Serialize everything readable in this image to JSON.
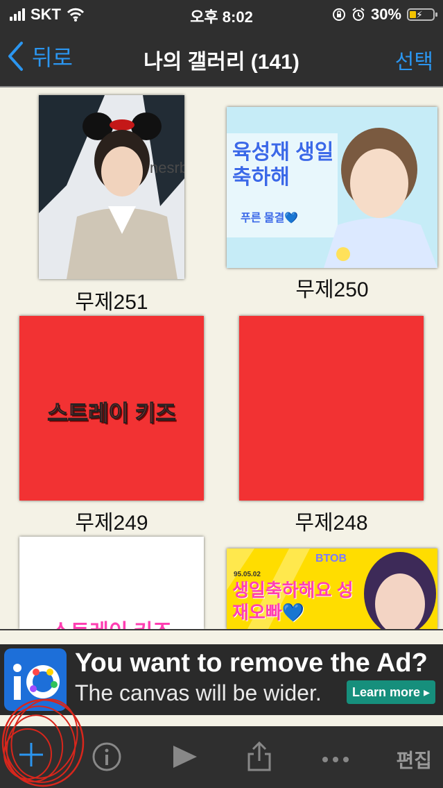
{
  "status": {
    "carrier": "SKT",
    "time": "오후 8:02",
    "battery": "30%"
  },
  "nav": {
    "back_label": "뒤로",
    "title": "나의 갤러리 (141)",
    "select_label": "선택"
  },
  "gallery": {
    "items": [
      {
        "caption": "무제251",
        "text": "nesrby"
      },
      {
        "caption": "무제250",
        "text": "육성재 생일축하해",
        "text2": "푸른 물결💙"
      },
      {
        "caption": "무제249",
        "text": "스트레이 키즈"
      },
      {
        "caption": "무제248"
      },
      {
        "caption": "",
        "text": "스트레이 키즈"
      },
      {
        "caption": "",
        "text": "BTOB",
        "text2": "생일축하해요 성재오빠💙",
        "date": "95.05.02"
      }
    ]
  },
  "ad": {
    "title": "You want to remove the Ad?",
    "subtitle": "The canvas will be wider.",
    "button": "Learn more ▸"
  },
  "toolbar": {
    "edit_label": "편집"
  },
  "colors": {
    "accent": "#2b96f0",
    "bar_bg": "#2f2f2f",
    "page_bg": "#f4f2e6",
    "red_canvas": "#f23233",
    "ad_button": "#168f7c"
  }
}
